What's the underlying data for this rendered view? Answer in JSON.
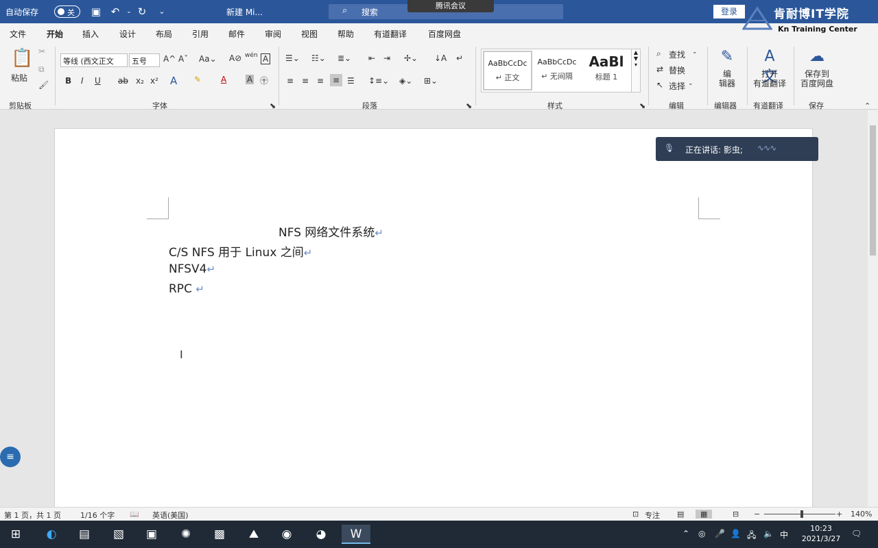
{
  "titlebar": {
    "autosave_label": "自动保存",
    "autosave_state": "关",
    "doc_title": "新建 Mi...",
    "search_placeholder": "搜索",
    "meeting_badge": "腾讯会议",
    "login_label": "登录",
    "brand_cn": "肯耐博IT学院",
    "brand_en": "Kn  Training Center"
  },
  "ribbon": {
    "tabs": [
      "文件",
      "开始",
      "插入",
      "设计",
      "布局",
      "引用",
      "邮件",
      "审阅",
      "视图",
      "帮助",
      "有道翻译",
      "百度网盘"
    ],
    "active_tab": "开始",
    "clipboard": {
      "paste_label": "粘贴",
      "group_label": "剪贴板"
    },
    "font": {
      "font_name": "等线 (西文正文",
      "font_size": "五号",
      "group_label": "字体"
    },
    "paragraph": {
      "group_label": "段落"
    },
    "styles": {
      "items": [
        {
          "sample": "AaBbCcDc",
          "name": "↵ 正文"
        },
        {
          "sample": "AaBbCcDc",
          "name": "↵ 无间隔"
        },
        {
          "sample": "AaBl",
          "name": "标题 1"
        }
      ],
      "group_label": "样式"
    },
    "editing": {
      "find": "查找",
      "replace": "替换",
      "select": "选择",
      "group_label": "编辑"
    },
    "editor": {
      "label": "编\n辑器",
      "group_label": "编辑器"
    },
    "youdao": {
      "label": "打开\n有道翻译",
      "group_label": "有道翻译"
    },
    "baidu": {
      "label": "保存到\n百度网盘",
      "group_label": "保存"
    }
  },
  "document": {
    "lines": [
      {
        "text": "NFS  网络文件系统"
      },
      {
        "text": "C/S NFS 用于 Linux 之间"
      },
      {
        "text": "NFSV4"
      },
      {
        "text": "RPC "
      }
    ],
    "para_mark": "↵"
  },
  "speaking": {
    "label": "正在讲话: 影虫;"
  },
  "statusbar": {
    "page": "第 1 页，共 1 页",
    "words": "1/16 个字",
    "language": "英语(美国)",
    "focus": "专注",
    "zoom": "140%",
    "zoom_minus": "−",
    "zoom_plus": "+"
  },
  "taskbar": {
    "time": "10:23",
    "date": "2021/3/27",
    "ime": "中"
  },
  "colors": {
    "accent": "#2b579a",
    "taskbar": "#1f2a36",
    "meeting_popup": "#2f3e55"
  }
}
